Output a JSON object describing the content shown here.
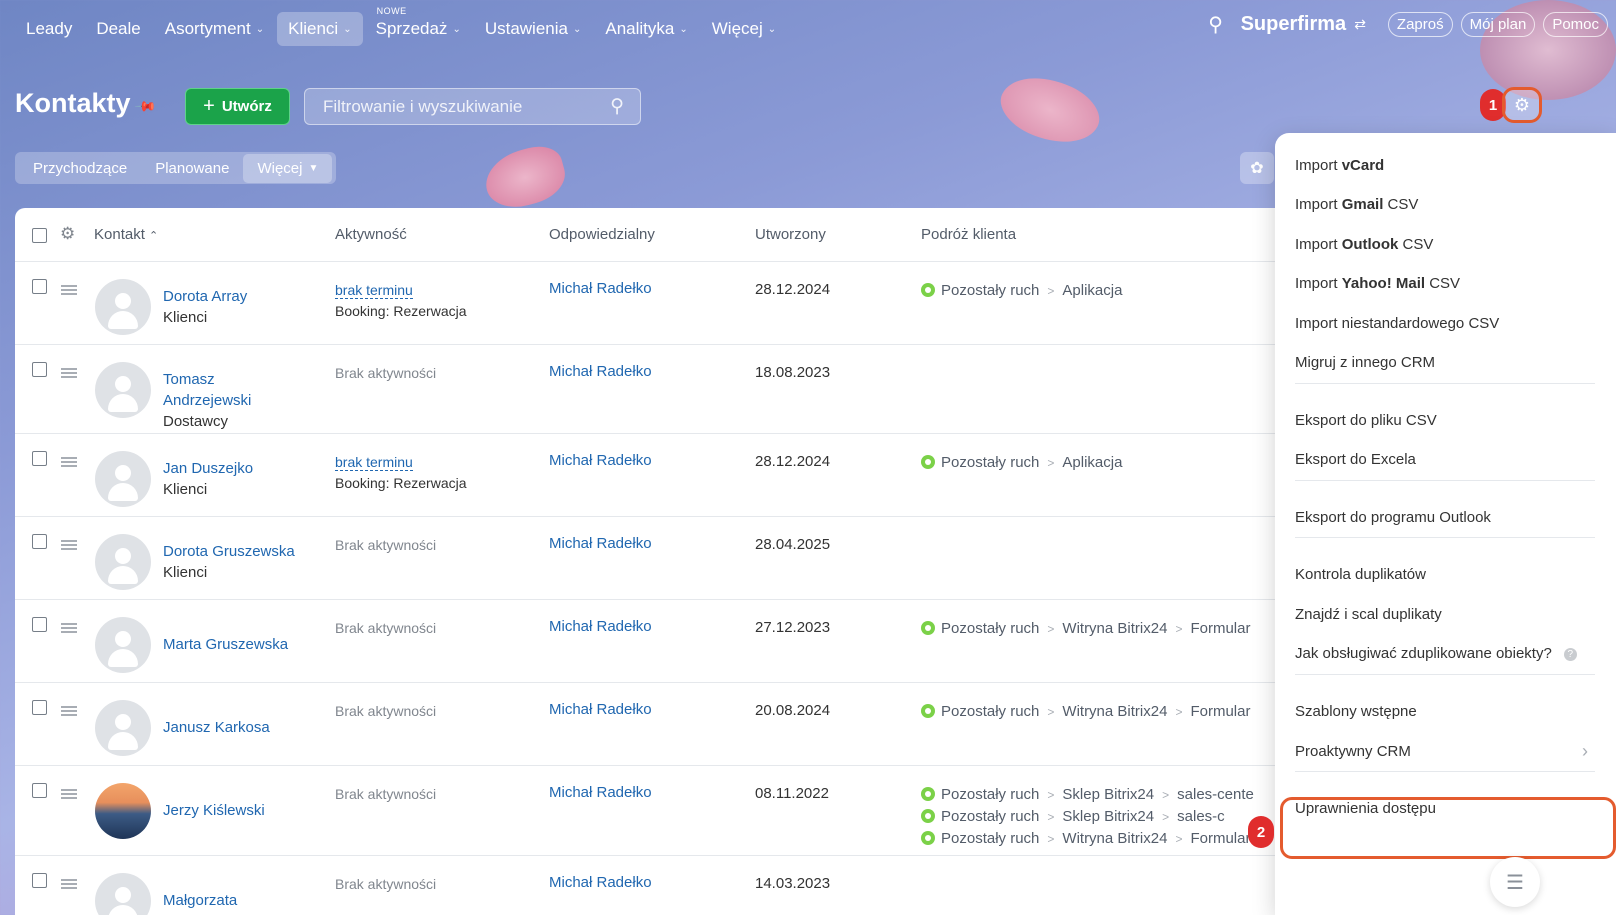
{
  "nav": {
    "items": [
      {
        "label": "Leady",
        "chevron": false,
        "active": false
      },
      {
        "label": "Deale",
        "chevron": false,
        "active": false
      },
      {
        "label": "Asortyment",
        "chevron": true,
        "active": false
      },
      {
        "label": "Klienci",
        "chevron": true,
        "active": true
      },
      {
        "label": "Sprzedaż",
        "chevron": true,
        "active": false,
        "badge": "NOWE"
      },
      {
        "label": "Ustawienia",
        "chevron": true,
        "active": false
      },
      {
        "label": "Analityka",
        "chevron": true,
        "active": false
      },
      {
        "label": "Więcej",
        "chevron": true,
        "active": false
      }
    ],
    "brand": "Superfirma",
    "invite": "Zaproś",
    "plan": "Mój plan",
    "help": "Pomoc"
  },
  "page": {
    "title": "Kontakty",
    "create_label": "Utwórz",
    "filter_placeholder": "Filtrowanie i wyszukiwanie",
    "badge1": "1",
    "badge2": "2"
  },
  "subtabs": [
    "Przychodzące",
    "Planowane",
    "Więcej"
  ],
  "table": {
    "headers": {
      "contact": "Kontakt",
      "activity": "Aktywność",
      "responsible": "Odpowiedzialny",
      "created": "Utworzony",
      "journey": "Podróż klienta"
    },
    "rows": [
      {
        "name": [
          "Dorota Array"
        ],
        "group": "Klienci",
        "act_link": "brak terminu",
        "act_text": "Booking: Rezerwacja",
        "resp": "Michał Radełko",
        "created": "28.12.2024",
        "journey": [
          [
            "Pozostały ruch",
            "Aplikacja"
          ]
        ]
      },
      {
        "name": [
          "Tomasz",
          "Andrzejewski"
        ],
        "group": "Dostawcy",
        "act_none": "Brak aktywności",
        "resp": "Michał Radełko",
        "created": "18.08.2023",
        "journey": []
      },
      {
        "name": [
          "Jan Duszejko"
        ],
        "group": "Klienci",
        "act_link": "brak terminu",
        "act_text": "Booking: Rezerwacja",
        "resp": "Michał Radełko",
        "created": "28.12.2024",
        "journey": [
          [
            "Pozostały ruch",
            "Aplikacja"
          ]
        ]
      },
      {
        "name": [
          "Dorota Gruszewska"
        ],
        "group": "Klienci",
        "act_none": "Brak aktywności",
        "resp": "Michał Radełko",
        "created": "28.04.2025",
        "journey": []
      },
      {
        "name": [
          "Marta Gruszewska"
        ],
        "group": "",
        "act_none": "Brak aktywności",
        "resp": "Michał Radełko",
        "created": "27.12.2023",
        "journey": [
          [
            "Pozostały ruch",
            "Witryna Bitrix24",
            "Formular"
          ]
        ]
      },
      {
        "name": [
          "Janusz Karkosa"
        ],
        "group": "",
        "act_none": "Brak aktywności",
        "resp": "Michał Radełko",
        "created": "20.08.2024",
        "journey": [
          [
            "Pozostały ruch",
            "Witryna Bitrix24",
            "Formular"
          ]
        ]
      },
      {
        "name": [
          "Jerzy Kiślewski"
        ],
        "group": "",
        "photo": true,
        "act_none": "Brak aktywności",
        "resp": "Michał Radełko",
        "created": "08.11.2022",
        "journey": [
          [
            "Pozostały ruch",
            "Sklep Bitrix24",
            "sales-cente"
          ],
          [
            "Pozostały ruch",
            "Sklep Bitrix24",
            "sales-c"
          ],
          [
            "Pozostały ruch",
            "Witryna Bitrix24",
            "Formular"
          ]
        ]
      },
      {
        "name": [
          "Małgorzata"
        ],
        "group": "",
        "act_none": "Brak aktywności",
        "resp": "Michał Radełko",
        "created": "14.03.2023",
        "journey": []
      }
    ]
  },
  "menu": {
    "groups": [
      [
        {
          "pre": "Import ",
          "bold": "vCard",
          "post": ""
        },
        {
          "pre": "Import ",
          "bold": "Gmail",
          "post": " CSV"
        },
        {
          "pre": "Import ",
          "bold": "Outlook",
          "post": " CSV"
        },
        {
          "pre": "Import ",
          "bold": "Yahoo! Mail",
          "post": " CSV"
        },
        {
          "pre": "Import niestandardowego CSV",
          "bold": "",
          "post": ""
        },
        {
          "pre": "Migruj z innego CRM",
          "bold": "",
          "post": ""
        }
      ],
      [
        {
          "pre": "Eksport do pliku CSV",
          "bold": "",
          "post": ""
        },
        {
          "pre": "Eksport do Excela",
          "bold": "",
          "post": ""
        }
      ],
      [
        {
          "pre": "Eksport do programu Outlook",
          "bold": "",
          "post": ""
        }
      ],
      [
        {
          "pre": "Kontrola duplikatów",
          "bold": "",
          "post": ""
        },
        {
          "pre": "Znajdź i scal duplikaty",
          "bold": "",
          "post": ""
        },
        {
          "pre": "Jak obsługiwać zduplikowane obiekty?",
          "bold": "",
          "post": "",
          "help": true
        }
      ],
      [
        {
          "pre": "Szablony wstępne",
          "bold": "",
          "post": ""
        },
        {
          "pre": "Proaktywny CRM",
          "bold": "",
          "post": "",
          "arrow": true
        }
      ],
      [
        {
          "pre": "Uprawnienia dostępu",
          "bold": "",
          "post": ""
        }
      ]
    ]
  },
  "icons": {
    "search": "search-icon",
    "gear": "gear-icon",
    "pin": "pin-icon"
  },
  "colors": {
    "accent_green": "#1ba34a",
    "link_blue": "#2067b0",
    "highlight": "#e45b2e",
    "badge_red": "#e02d2d"
  }
}
